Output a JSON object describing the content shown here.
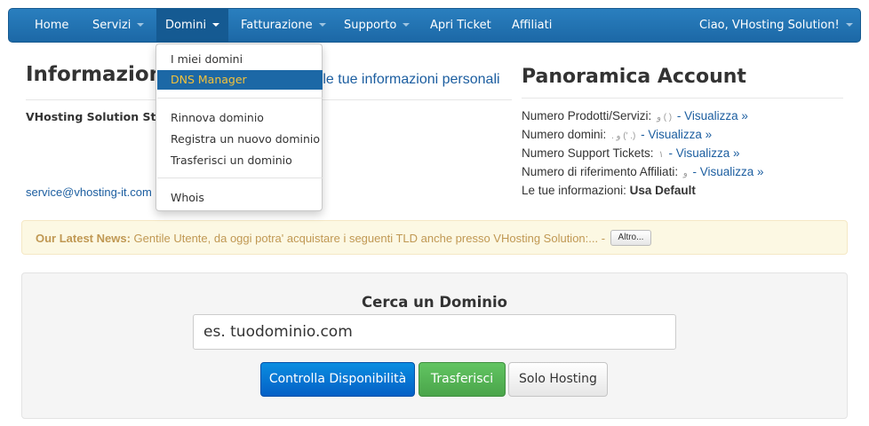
{
  "navbar": {
    "items": [
      {
        "label": "Home",
        "dropdown": false
      },
      {
        "label": "Servizi",
        "dropdown": true
      },
      {
        "label": "Domini",
        "dropdown": true,
        "active": true
      },
      {
        "label": "Fatturazione",
        "dropdown": true
      },
      {
        "label": "Supporto",
        "dropdown": true
      },
      {
        "label": "Apri Ticket",
        "dropdown": false
      },
      {
        "label": "Affiliati",
        "dropdown": false
      }
    ],
    "user_greeting": "Ciao, VHosting Solution!"
  },
  "domini_menu": {
    "items": [
      "I miei domini",
      "DNS Manager",
      "Rinnova dominio",
      "Registra un nuovo dominio",
      "Trasferisci un dominio",
      "Whois"
    ],
    "highlighted": "DNS Manager"
  },
  "info": {
    "title": "Informazioni",
    "subtitle": "a le tue informazioni personali",
    "company": "VHosting Solution Staff",
    "email": "service@vhosting-it.com"
  },
  "account": {
    "title": "Panoramica Account",
    "rows": [
      {
        "label": "Numero Prodotti/Servizi:",
        "value": "و ( )",
        "link": "- Visualizza »"
      },
      {
        "label": "Numero domini:",
        "value": ". و (' .)",
        "link": "- Visualizza »"
      },
      {
        "label": "Numero Support Tickets:",
        "value": "١",
        "link": "- Visualizza »"
      },
      {
        "label": "Numero di riferimento Affiliati:",
        "value": "و",
        "link": "- Visualizza »"
      }
    ],
    "info_label": "Le tue informazioni:",
    "info_value": "Usa Default"
  },
  "news": {
    "label": "Our Latest News:",
    "text": "Gentile Utente, da oggi potra' acquistare i seguenti TLD anche presso VHosting Solution:... -",
    "button": "Altro..."
  },
  "domain_search": {
    "title": "Cerca un Dominio",
    "placeholder": "es. tuodominio.com",
    "buttons": {
      "check": "Controlla  Disponibilità",
      "transfer": "Trasferisci",
      "hosting": "Solo Hosting"
    }
  },
  "colors": {
    "navbar": "#1c68a6",
    "link": "#1c5ea0",
    "news_text": "#c09853",
    "news_bg": "#fcf8e3",
    "highlight_text": "#f3c23b"
  }
}
